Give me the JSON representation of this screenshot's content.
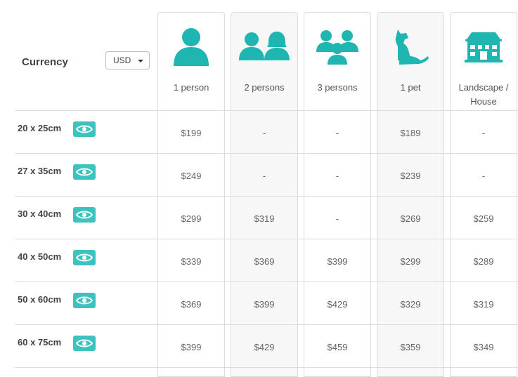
{
  "currency": {
    "label": "Currency",
    "selected": "USD"
  },
  "accent_color": "#1fb5b0",
  "columns": [
    {
      "label": "1 person",
      "icon": "one-person-icon"
    },
    {
      "label": "2 persons",
      "icon": "two-persons-icon"
    },
    {
      "label": "3 persons",
      "icon": "three-persons-icon"
    },
    {
      "label": "1 pet",
      "icon": "dog-icon"
    },
    {
      "label": "Landscape / House",
      "icon": "house-icon"
    }
  ],
  "rows": [
    {
      "size": "20 x 25cm",
      "prices": [
        "$199",
        "-",
        "-",
        "$189",
        "-"
      ]
    },
    {
      "size": "27 x 35cm",
      "prices": [
        "$249",
        "-",
        "-",
        "$239",
        "-"
      ]
    },
    {
      "size": "30 x 40cm",
      "prices": [
        "$299",
        "$319",
        "-",
        "$269",
        "$259"
      ]
    },
    {
      "size": "40 x 50cm",
      "prices": [
        "$339",
        "$369",
        "$399",
        "$299",
        "$289"
      ]
    },
    {
      "size": "50 x 60cm",
      "prices": [
        "$369",
        "$399",
        "$429",
        "$329",
        "$319"
      ]
    },
    {
      "size": "60 x 75cm",
      "prices": [
        "$399",
        "$429",
        "$459",
        "$359",
        "$349"
      ]
    }
  ]
}
